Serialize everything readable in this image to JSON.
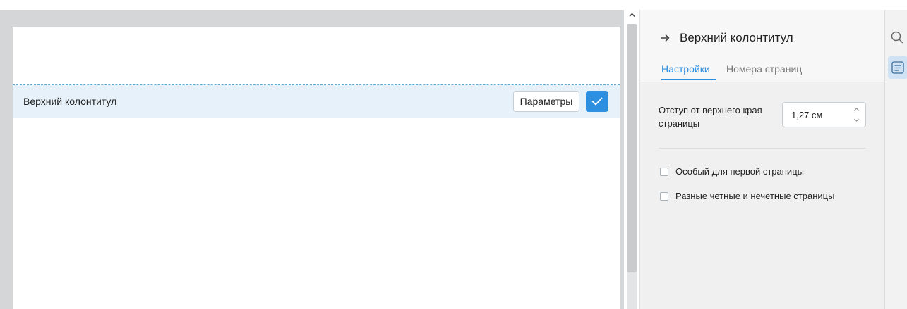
{
  "document": {
    "header_label": "Верхний колонтитул",
    "params_button": "Параметры"
  },
  "panel": {
    "title": "Верхний колонтитул",
    "tabs": [
      "Настройки",
      "Номера страниц"
    ],
    "active_tab": 0,
    "indent": {
      "label": "Отступ от верхнего края страницы",
      "value": "1,27 см"
    },
    "checkboxes": [
      {
        "label": "Особый для первой страницы",
        "checked": false
      },
      {
        "label": "Разные четные и нечетные страницы",
        "checked": false
      }
    ]
  },
  "colors": {
    "accent": "#2d8fe0",
    "header_band": "#e6f1fa",
    "doc_background": "#d4d6d8",
    "panel_background": "#f0f0f0"
  },
  "icons": {
    "back": "arrow-right-icon",
    "confirm": "checkmark-icon",
    "search": "search-icon",
    "header": "header-footer-icon"
  }
}
